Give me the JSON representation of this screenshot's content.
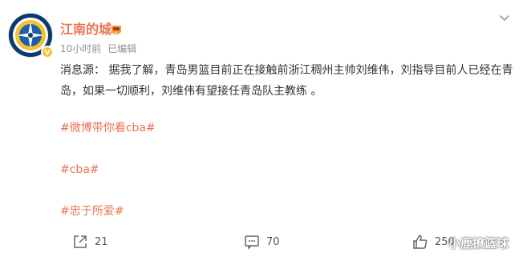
{
  "user": {
    "name": "江南的城",
    "avatar_icon": "compass-emblem-icon",
    "verified_icon": "verified-v-badge-icon",
    "fan_badge_icon": "fan-badge-icon"
  },
  "meta": {
    "time": "10小时前",
    "edited": "已编辑"
  },
  "post": {
    "body": "消息源：  据我了解，青岛男篮目前正在接触前浙江稠州主帅刘维伟，刘指导目前人已经在青岛，如果一切顺利，刘维伟有望接任青岛队主教练 。",
    "topics": [
      "#微博带你看cba#",
      "#cba#",
      "#忠于所爱#"
    ]
  },
  "actions": {
    "share_count": "21",
    "comment_count": "70",
    "like_count": "250"
  },
  "watermark": "小鹿撩篮球",
  "colors": {
    "accent": "#eb7350",
    "meta": "#939393",
    "text": "#333333"
  }
}
